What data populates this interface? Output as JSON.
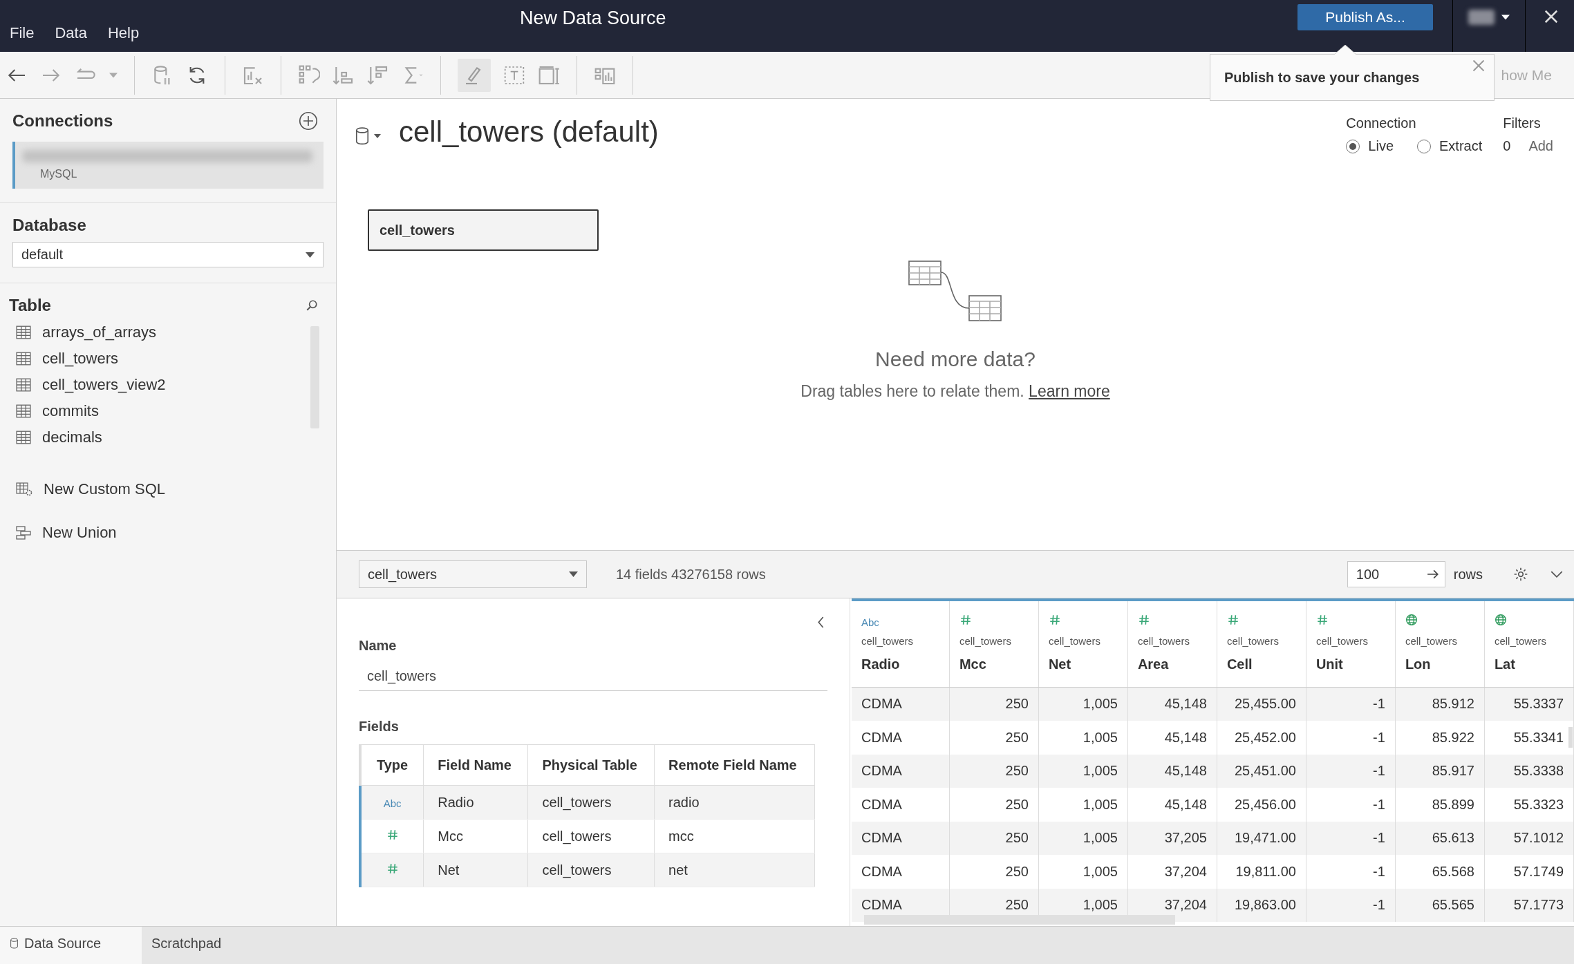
{
  "menu": [
    {
      "label": "File"
    },
    {
      "label": "Data"
    },
    {
      "label": "Help"
    }
  ],
  "window": {
    "title": "New Data Source"
  },
  "publish_button": {
    "label": "Publish As..."
  },
  "toolbar": {
    "show_me": "how Me"
  },
  "tooltip": {
    "text": "Publish to save your changes"
  },
  "connections": {
    "title": "Connections",
    "items": [
      {
        "type": "MySQL",
        "selected": true
      }
    ]
  },
  "database": {
    "label": "Database",
    "value": "default"
  },
  "tables": {
    "title": "Table",
    "items": [
      "arrays_of_arrays",
      "cell_towers",
      "cell_towers_view2",
      "commits",
      "decimals"
    ]
  },
  "actions": [
    {
      "kind": "custom_sql",
      "label": "New Custom SQL"
    },
    {
      "kind": "union",
      "label": "New Union"
    }
  ],
  "datasource": {
    "title": "cell_towers (default)",
    "connection_label": "Connection",
    "connection_options": [
      {
        "label": "Live",
        "selected": true
      },
      {
        "label": "Extract",
        "selected": false
      }
    ],
    "filters_label": "Filters",
    "filters_count": "0",
    "filters_add": "Add"
  },
  "canvas": {
    "tables": [
      "cell_towers"
    ],
    "empty_title": "Need more data?",
    "empty_text": "Drag tables here to relate them.",
    "empty_link": "Learn more"
  },
  "preview_bar": {
    "table": "cell_towers",
    "summary": "14 fields 43276158 rows",
    "rows_value": "100",
    "rows_label": "rows"
  },
  "metadata": {
    "name_label": "Name",
    "name_value": "cell_towers",
    "fields_label": "Fields",
    "columns": [
      "Type",
      "Field Name",
      "Physical Table",
      "Remote Field Name"
    ],
    "rows": [
      {
        "kind": "string",
        "type_label": "Abc",
        "field": "Radio",
        "table": "cell_towers",
        "remote": "radio",
        "selected": true
      },
      {
        "kind": "number",
        "field": "Mcc",
        "table": "cell_towers",
        "remote": "mcc",
        "selected": true
      },
      {
        "kind": "number",
        "field": "Net",
        "table": "cell_towers",
        "remote": "net",
        "selected": true
      }
    ]
  },
  "grid": {
    "columns": [
      {
        "kind": "string",
        "type_label": "Abc",
        "source": "cell_towers",
        "name": "Radio"
      },
      {
        "kind": "number",
        "source": "cell_towers",
        "name": "Mcc"
      },
      {
        "kind": "number",
        "source": "cell_towers",
        "name": "Net"
      },
      {
        "kind": "number",
        "source": "cell_towers",
        "name": "Area"
      },
      {
        "kind": "number",
        "source": "cell_towers",
        "name": "Cell"
      },
      {
        "kind": "number",
        "source": "cell_towers",
        "name": "Unit"
      },
      {
        "kind": "geo",
        "source": "cell_towers",
        "name": "Lon"
      },
      {
        "kind": "geo",
        "source": "cell_towers",
        "name": "Lat"
      }
    ],
    "rows": [
      [
        "CDMA",
        "250",
        "1,005",
        "45,148",
        "25,455.00",
        "-1",
        "85.912",
        "55.3337"
      ],
      [
        "CDMA",
        "250",
        "1,005",
        "45,148",
        "25,452.00",
        "-1",
        "85.922",
        "55.3341"
      ],
      [
        "CDMA",
        "250",
        "1,005",
        "45,148",
        "25,451.00",
        "-1",
        "85.917",
        "55.3338"
      ],
      [
        "CDMA",
        "250",
        "1,005",
        "45,148",
        "25,456.00",
        "-1",
        "85.899",
        "55.3323"
      ],
      [
        "CDMA",
        "250",
        "1,005",
        "37,205",
        "19,471.00",
        "-1",
        "65.613",
        "57.1012"
      ],
      [
        "CDMA",
        "250",
        "1,005",
        "37,204",
        "19,811.00",
        "-1",
        "65.568",
        "57.1749"
      ],
      [
        "CDMA",
        "250",
        "1,005",
        "37,204",
        "19,863.00",
        "-1",
        "65.565",
        "57.1773"
      ]
    ]
  },
  "bottom_tabs": [
    {
      "label": "Data Source",
      "selected": true
    },
    {
      "label": "Scratchpad",
      "selected": false
    }
  ]
}
